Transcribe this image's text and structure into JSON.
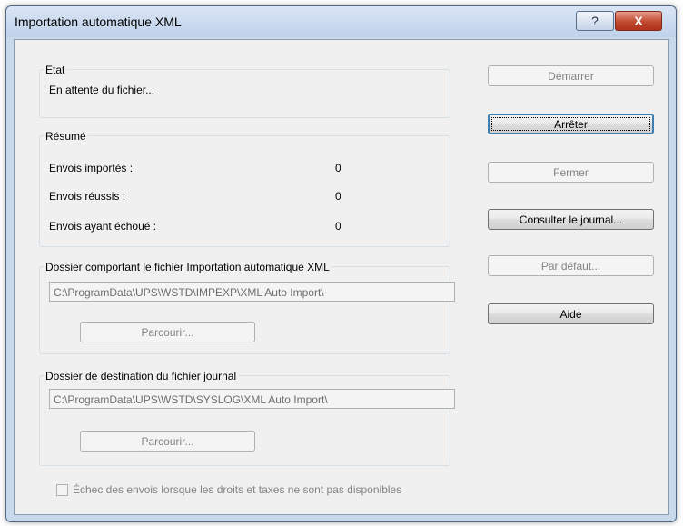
{
  "window": {
    "title": "Importation automatique XML",
    "help_glyph": "?",
    "close_glyph": "X"
  },
  "etat": {
    "legend": "Etat",
    "status": "En attente du fichier..."
  },
  "resume": {
    "legend": "Résumé",
    "rows": [
      {
        "label": "Envois importés :",
        "value": "0"
      },
      {
        "label": "Envois réussis :",
        "value": "0"
      },
      {
        "label": "Envois ayant échoué :",
        "value": "0"
      }
    ]
  },
  "import_folder": {
    "legend": "Dossier comportant le fichier Importation automatique XML",
    "path": "C:\\ProgramData\\UPS\\WSTD\\IMPEXP\\XML Auto Import\\",
    "browse_label": "Parcourir..."
  },
  "log_folder": {
    "legend": "Dossier de destination du fichier journal",
    "path": "C:\\ProgramData\\UPS\\WSTD\\SYSLOG\\XML Auto Import\\",
    "browse_label": "Parcourir..."
  },
  "checkbox": {
    "label": "Échec des envois lorsque les droits et taxes ne sont pas disponibles",
    "checked": false
  },
  "buttons": {
    "start": "Démarrer",
    "stop": "Arrêter",
    "close": "Fermer",
    "view_log": "Consulter le journal...",
    "default": "Par défaut...",
    "help": "Aide"
  }
}
